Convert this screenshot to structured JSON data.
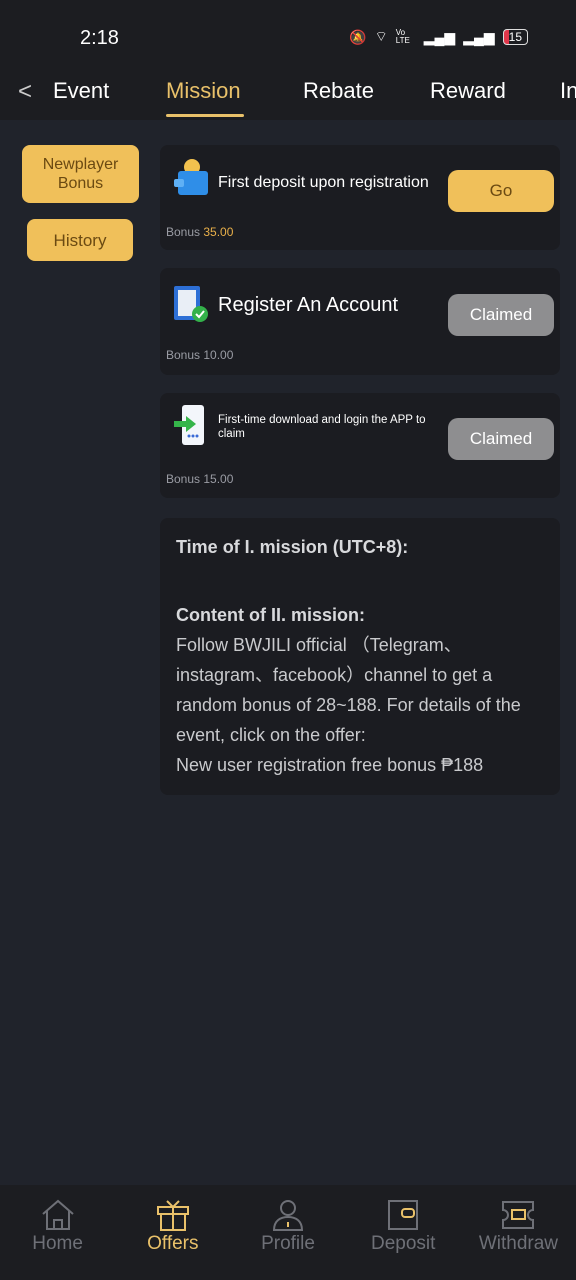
{
  "status": {
    "time": "2:18",
    "battery": "15",
    "network": "Vo LTE"
  },
  "tabs": {
    "back": "<",
    "items": [
      "Event",
      "Mission",
      "Rebate",
      "Reward",
      "In"
    ],
    "active": "Mission"
  },
  "sidebar": {
    "newplayer": "Newplayer Bonus",
    "history": "History"
  },
  "missions": [
    {
      "title": "First deposit upon registration",
      "button": "Go",
      "bonus_label": "Bonus",
      "bonus": "35.00",
      "icon": "wallet-coin-icon"
    },
    {
      "title": "Register An Account",
      "button": "Claimed",
      "bonus_label": "Bonus",
      "bonus": "10.00",
      "icon": "clipboard-check-icon"
    },
    {
      "title": "First-time download and login the APP to claim",
      "button": "Claimed",
      "bonus_label": "Bonus",
      "bonus": "15.00",
      "icon": "phone-login-icon"
    }
  ],
  "rules": {
    "time_heading": "Time of I. mission (UTC+8):",
    "content_heading": "Content of II. mission:",
    "content": "Follow BWJILI official （Telegram、instagram、facebook）channel to get a random bonus of 28~188. For details of the event, click on the offer:",
    "offer": "New user registration free bonus ₱188"
  },
  "nav": [
    "Home",
    "Offers",
    "Profile",
    "Deposit",
    "Withdraw"
  ],
  "colors": {
    "accent": "#f0c05a",
    "background": "#20232b",
    "card": "#1b1c21"
  }
}
